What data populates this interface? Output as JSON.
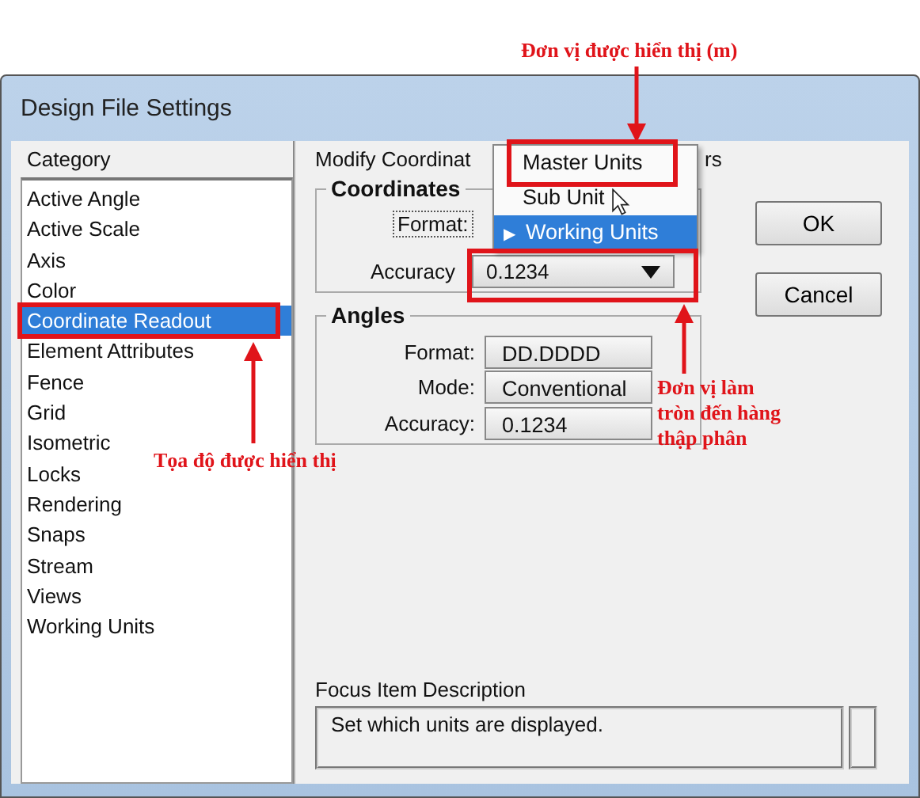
{
  "window": {
    "title": "Design File Settings"
  },
  "category": {
    "label": "Category",
    "items": [
      {
        "label": "Active Angle",
        "selected": false
      },
      {
        "label": "Active Scale",
        "selected": false
      },
      {
        "label": "Axis",
        "selected": false
      },
      {
        "label": "Color",
        "selected": false
      },
      {
        "label": "Coordinate Readout",
        "selected": true
      },
      {
        "label": "Element Attributes",
        "selected": false
      },
      {
        "label": "Fence",
        "selected": false
      },
      {
        "label": "Grid",
        "selected": false
      },
      {
        "label": "Isometric",
        "selected": false
      },
      {
        "label": "Locks",
        "selected": false
      },
      {
        "label": "Rendering",
        "selected": false
      },
      {
        "label": "Snaps",
        "selected": false
      },
      {
        "label": "Stream",
        "selected": false
      },
      {
        "label": "Views",
        "selected": false
      },
      {
        "label": "Working Units",
        "selected": false
      }
    ]
  },
  "header": {
    "left": "Modify Coordinat",
    "right": "rs"
  },
  "coordinates": {
    "title": "Coordinates",
    "format_label": "Format:",
    "accuracy_label": "Accuracy",
    "accuracy_value": "0.1234"
  },
  "format_menu": {
    "items": [
      {
        "label": "Master Units",
        "selected": false
      },
      {
        "label": "Sub Unit",
        "selected": false
      },
      {
        "label": "Working Units",
        "selected": true,
        "marker": "▶"
      }
    ]
  },
  "angles": {
    "title": "Angles",
    "rows": [
      {
        "label": "Format:",
        "value": "DD.DDDD"
      },
      {
        "label": "Mode:",
        "value": "Conventional"
      },
      {
        "label": "Accuracy:",
        "value": "0.1234"
      }
    ]
  },
  "buttons": [
    "OK",
    "Cancel"
  ],
  "focus": {
    "label": "Focus Item Description",
    "text": "Set which units are displayed."
  },
  "annotations": {
    "display_units": "Đơn vị được hiển thị (m)",
    "rounding": "Đơn vị làm\ntròn đến hàng\nthập phân",
    "readout": "Tọa độ được hiển thị"
  }
}
